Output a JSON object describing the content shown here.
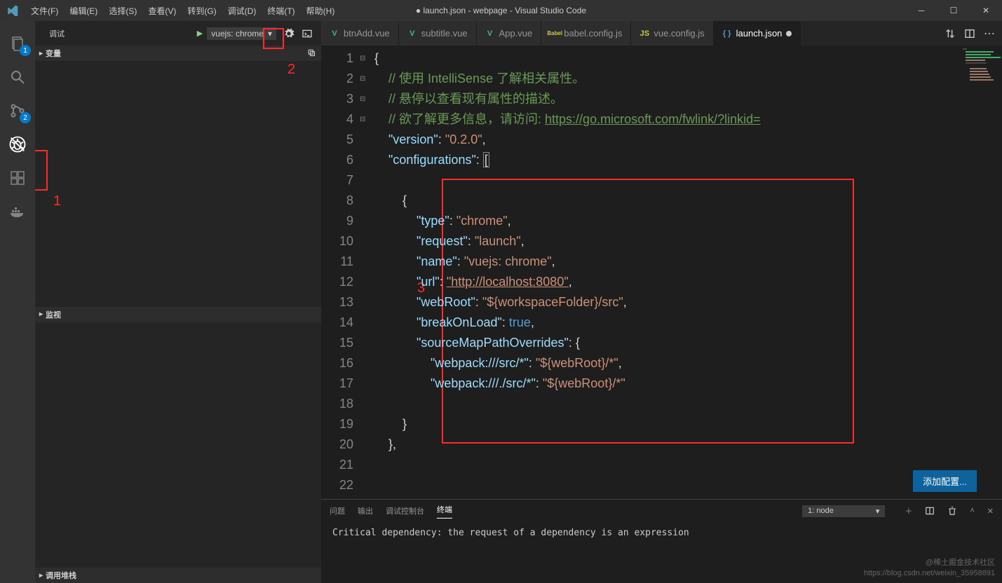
{
  "titlebar": {
    "menus": [
      "文件(F)",
      "编辑(E)",
      "选择(S)",
      "查看(V)",
      "转到(G)",
      "调试(D)",
      "终端(T)",
      "帮助(H)"
    ],
    "title": "● launch.json - webpage - Visual Studio Code"
  },
  "activitybar": {
    "badges": {
      "explorer": "1",
      "scm": "2"
    }
  },
  "sidebar": {
    "title": "调试",
    "config_name": "vuejs: chrome",
    "sections": {
      "variables": "变量",
      "watch": "监视",
      "callstack": "调用堆栈"
    }
  },
  "tabs": [
    {
      "icon": "V",
      "color": "#41b883",
      "label": "btnAdd.vue",
      "active": false
    },
    {
      "icon": "V",
      "color": "#41b883",
      "label": "subtitle.vue",
      "active": false
    },
    {
      "icon": "V",
      "color": "#41b883",
      "label": "App.vue",
      "active": false
    },
    {
      "icon": "B",
      "color": "#cbcb41",
      "label": "babel.config.js",
      "active": false,
      "prefix": "Babel"
    },
    {
      "icon": "JS",
      "color": "#cbcb41",
      "label": "vue.config.js",
      "active": false
    },
    {
      "icon": "{}",
      "color": "#519aba",
      "label": "launch.json",
      "active": true,
      "dirty": true
    }
  ],
  "editor": {
    "line_numbers": [
      "1",
      "2",
      "3",
      "4",
      "5",
      "6",
      "7",
      "8",
      "9",
      "10",
      "11",
      "12",
      "13",
      "14",
      "15",
      "16",
      "17",
      "18",
      "19",
      "20",
      "21",
      "22"
    ],
    "code": {
      "l1": "{",
      "c1": "// 使用 IntelliSense 了解相关属性。",
      "c2": "// 悬停以查看现有属性的描述。",
      "c3a": "// 欲了解更多信息，请访问: ",
      "c3b": "https://go.microsoft.com/fwlink/?linkid=",
      "version_k": "\"version\"",
      "version_v": "\"0.2.0\"",
      "configs_k": "\"configurations\"",
      "obj_open": "{",
      "type_k": "\"type\"",
      "type_v": "\"chrome\"",
      "request_k": "\"request\"",
      "request_v": "\"launch\"",
      "name_k": "\"name\"",
      "name_v": "\"vuejs: chrome\"",
      "url_k": "\"url\"",
      "url_v": "\"http://localhost:8080\"",
      "webroot_k": "\"webRoot\"",
      "webroot_v": "\"${workspaceFolder}/src\"",
      "bol_k": "\"breakOnLoad\"",
      "bol_v": "true",
      "smpo_k": "\"sourceMapPathOverrides\"",
      "wp1_k": "\"webpack:///src/*\"",
      "wp1_v": "\"${webRoot}/*\"",
      "wp2_k": "\"webpack:///./src/*\"",
      "wp2_v": "\"${webRoot}/*\"",
      "obj_close": "}",
      "arr_close": "},"
    }
  },
  "add_config_btn": "添加配置...",
  "panel": {
    "tabs": [
      "问题",
      "输出",
      "调试控制台",
      "终端"
    ],
    "active_tab": 3,
    "select": "1: node",
    "output": "Critical dependency: the request of a dependency is an expression"
  },
  "watermark": {
    "l1": "@稀土掘金技术社区",
    "l2": "https://blog.csdn.net/weixin_35958891"
  },
  "annotations": {
    "a1": "1",
    "a2": "2",
    "a3": "3"
  }
}
